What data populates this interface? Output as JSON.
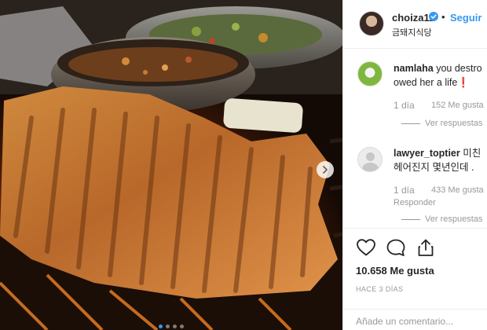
{
  "post": {
    "username": "choiza11",
    "follow_label": "Seguir",
    "separator": "•",
    "location": "금돼지식당"
  },
  "photo": {
    "icons": {
      "next": "chevron-right-icon",
      "verified": "verified-badge-icon"
    },
    "carousel_position": 1
  },
  "comments": [
    {
      "user": "namlaha",
      "text_line1": "you destro",
      "text_line2": "owed her a life❗",
      "age": "1 día",
      "likes": "152 Me gusta",
      "view_replies": "Ver respuestas"
    },
    {
      "user": "lawyer_toptier",
      "text_line1": "미친",
      "text_line2": "헤어진지 몇년인데 .",
      "age": "1 día",
      "likes": "433 Me gusta",
      "reply": "Responder",
      "view_replies": "Ver respuestas"
    }
  ],
  "actions": {
    "icons": [
      "heart-icon",
      "comment-bubble-icon",
      "share-icon"
    ],
    "likes_count": "10.658 Me gusta",
    "time_ago": "HACE 3 DÍAS",
    "add_comment_placeholder": "Añade un comentario..."
  },
  "colors": {
    "link_blue": "#3897f0",
    "text": "#262626",
    "muted": "#999999",
    "border": "#efefef"
  }
}
